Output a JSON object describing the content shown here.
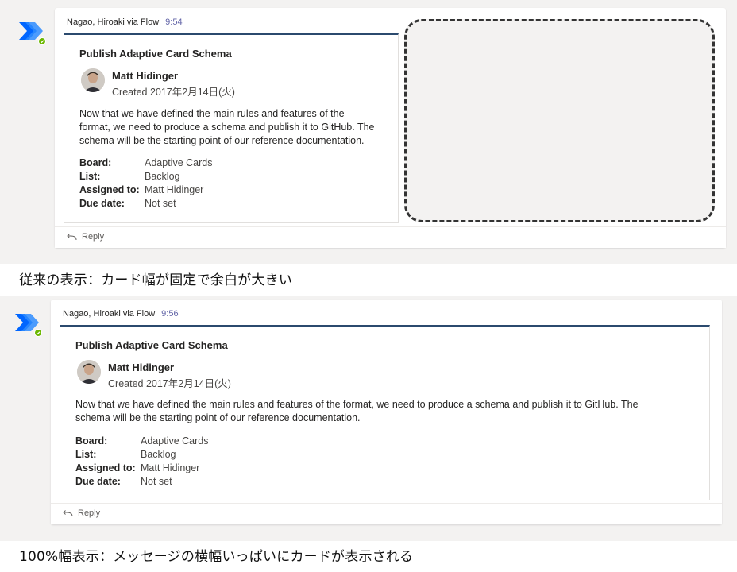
{
  "colors": {
    "accent": "#6264a7",
    "card_top_border": "#2b4a6e",
    "panel_bg": "#f3f2f1",
    "status_green": "#6bb700"
  },
  "example1": {
    "sender": "Nagao, Hiroaki via Flow",
    "time": "9:54",
    "card": {
      "title": "Publish Adaptive Card Schema",
      "person_name": "Matt Hidinger",
      "created": "Created 2017年2月14日(火)",
      "description_lines": [
        "Now that we have defined the main rules and features of the",
        "format, we need to produce a schema and publish it to GitHub. The",
        "schema will be the starting point of our reference documentation."
      ],
      "facts": [
        {
          "key": "Board:",
          "value": "Adaptive Cards"
        },
        {
          "key": "List:",
          "value": "Backlog"
        },
        {
          "key": "Assigned to:",
          "value": "Matt Hidinger"
        },
        {
          "key": "Due date:",
          "value": "Not set"
        }
      ]
    },
    "reply_label": "Reply",
    "caption": "従来の表示：カード幅が固定で余白が大きい"
  },
  "example2": {
    "sender": "Nagao, Hiroaki via Flow",
    "time": "9:56",
    "card": {
      "title": "Publish Adaptive Card Schema",
      "person_name": "Matt Hidinger",
      "created": "Created 2017年2月14日(火)",
      "description_lines": [
        "Now that we have defined the main rules and features of the format, we need to produce a schema and publish it to GitHub. The",
        "schema will be the starting point of our reference documentation."
      ],
      "facts": [
        {
          "key": "Board:",
          "value": "Adaptive Cards"
        },
        {
          "key": "List:",
          "value": "Backlog"
        },
        {
          "key": "Assigned to:",
          "value": "Matt Hidinger"
        },
        {
          "key": "Due date:",
          "value": "Not set"
        }
      ]
    },
    "reply_label": "Reply",
    "caption": "100%幅表示：メッセージの横幅いっぱいにカードが表示される"
  }
}
